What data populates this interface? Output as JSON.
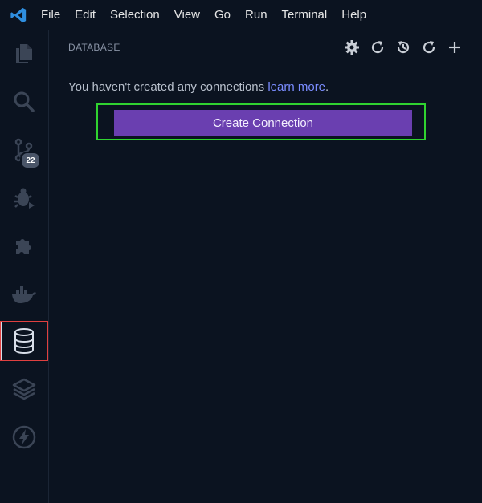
{
  "menu": {
    "logo_icon": "vscode-logo-icon",
    "items": [
      "File",
      "Edit",
      "Selection",
      "View",
      "Go",
      "Run",
      "Terminal",
      "Help"
    ]
  },
  "activity_bar": {
    "items": [
      {
        "icon": "files-icon"
      },
      {
        "icon": "search-icon"
      },
      {
        "icon": "source-control-icon",
        "badge": "22"
      },
      {
        "icon": "run-debug-icon"
      },
      {
        "icon": "extensions-icon"
      },
      {
        "icon": "docker-icon"
      },
      {
        "icon": "database-icon",
        "active": true
      },
      {
        "icon": "layers-icon"
      },
      {
        "icon": "lightning-icon"
      }
    ]
  },
  "panel": {
    "title": "DATABASE",
    "actions": [
      "settings-gear-icon",
      "refresh-icon",
      "history-icon",
      "reload-icon",
      "add-icon"
    ],
    "message": "You haven't created any connections ",
    "link": "learn more",
    "message_end": ".",
    "create_button": "Create Connection"
  },
  "colors": {
    "background": "#0b1320",
    "button": "#6a3fb0",
    "highlight_green": "#30d330",
    "highlight_red": "#e04040",
    "link": "#7a8cff"
  }
}
